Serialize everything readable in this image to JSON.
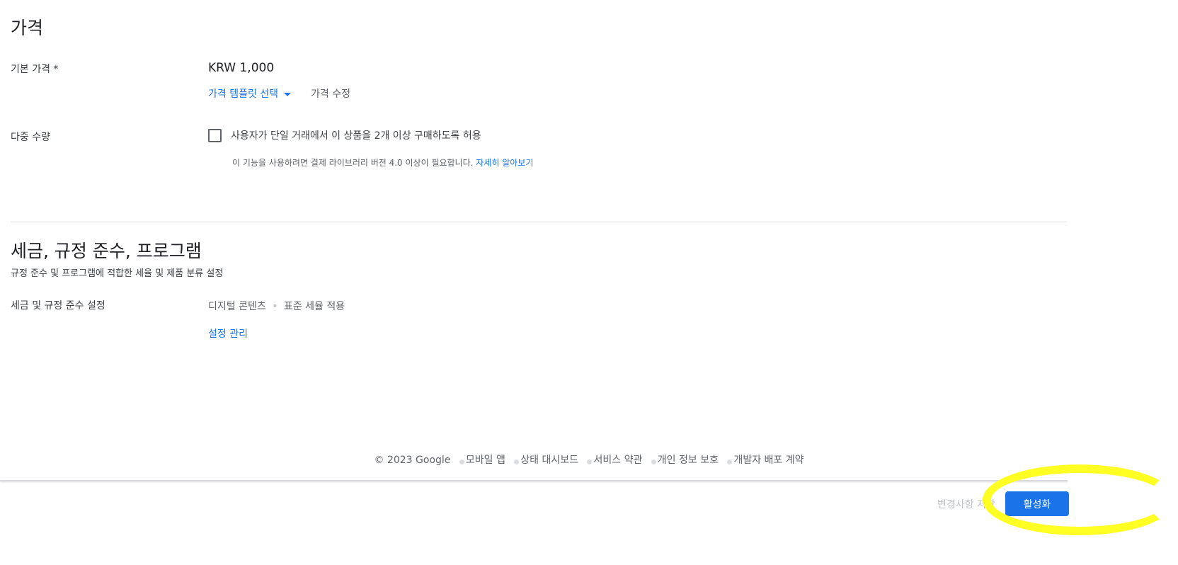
{
  "pricing": {
    "title": "가격",
    "base_price_label": "기본 가격 *",
    "base_price_value": "KRW 1,000",
    "template_select_label": "가격 템플릿 선택",
    "edit_price_label": "가격 수정",
    "multi_quantity_label": "다중 수량",
    "multi_quantity_checkbox_label": "사용자가 단일 거래에서 이 상품을 2개 이상 구매하도록 허용",
    "multi_quantity_note": "이 기능을 사용하려면 결제 라이브러리 버전 4.0 이상이 필요합니다.",
    "learn_more_label": "자세히 알아보기",
    "multi_quantity_checked": false
  },
  "tax": {
    "title": "세금, 규정 준수, 프로그램",
    "subtitle": "규정 준수 및 프로그램에 적합한 세율 및 제품 분류 설정",
    "settings_label": "세금 및 규정 준수 설정",
    "category_value": "디지털 콘텐츠",
    "tax_rate_value": "표준 세율 적용",
    "manage_settings_label": "설정 관리"
  },
  "footer": {
    "copyright": "© 2023 Google",
    "links": [
      "모바일 앱",
      "상태 대시보드",
      "서비스 약관",
      "개인 정보 보호",
      "개발자 배포 계약"
    ]
  },
  "action_bar": {
    "save_label": "변경사항 저장",
    "activate_label": "활성화"
  },
  "colors": {
    "accent": "#1a73e8",
    "highlight": "#ffff24"
  }
}
